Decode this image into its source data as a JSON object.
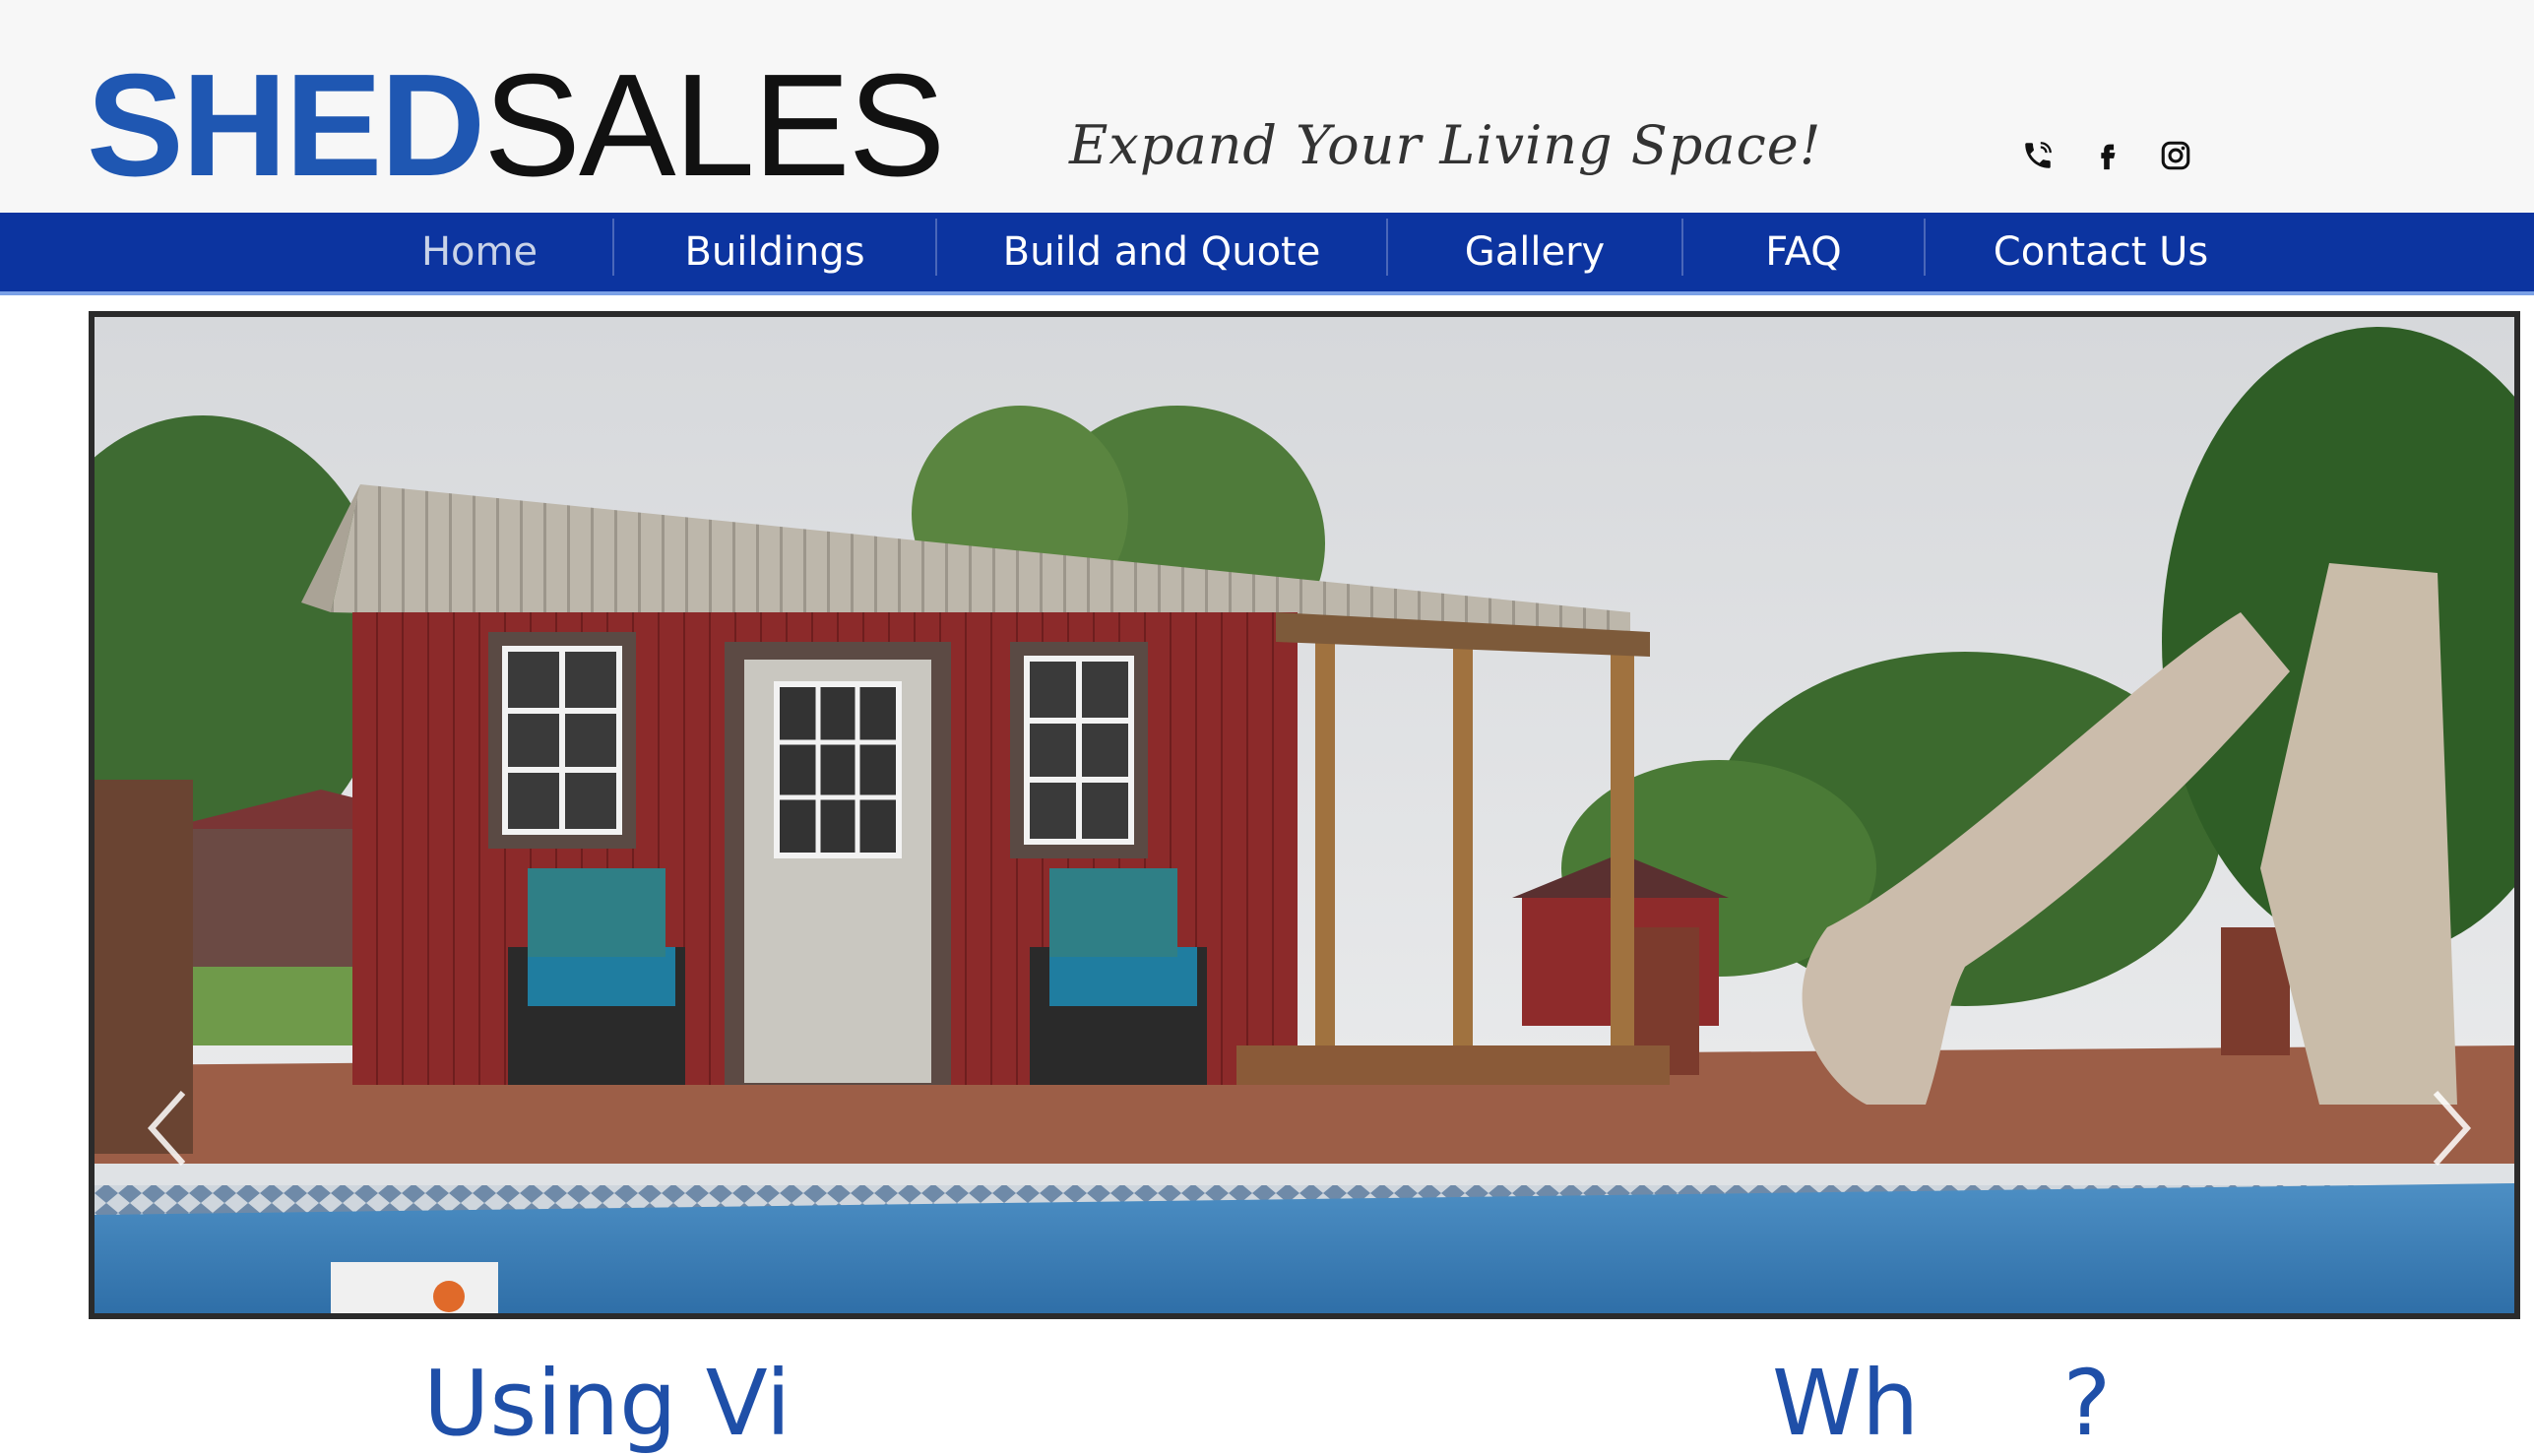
{
  "logo": {
    "part1": "SHED",
    "part2": "SALES"
  },
  "tagline": "Expand Your Living Space!",
  "social": [
    {
      "icon": "phone-icon"
    },
    {
      "icon": "facebook-icon"
    },
    {
      "icon": "instagram-icon"
    }
  ],
  "nav": [
    {
      "label": "Home",
      "active": true
    },
    {
      "label": "Buildings"
    },
    {
      "label": "Build and Quote"
    },
    {
      "label": "Gallery"
    },
    {
      "label": "FAQ"
    },
    {
      "label": "Contact Us"
    }
  ],
  "hero": {
    "prev_icon": "chevron-left-icon",
    "next_icon": "chevron-right-icon"
  },
  "below": {
    "left_heading": "Using Vi",
    "right_heading": "Wh     ?"
  },
  "colors": {
    "brand_blue": "#1f57b2",
    "nav_blue": "#0c34a0",
    "header_bg": "#f7f7f7"
  }
}
